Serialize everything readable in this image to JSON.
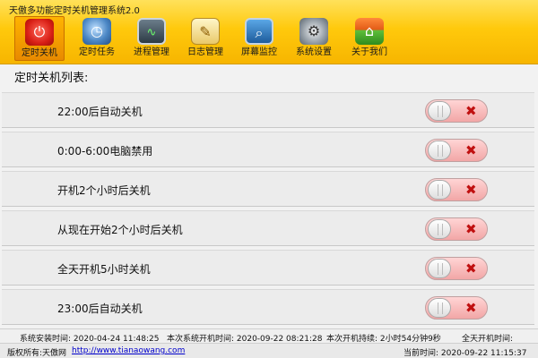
{
  "app": {
    "title": "天傲多功能定时关机管理系统2.0"
  },
  "toolbar": {
    "items": [
      {
        "label": "定时关机",
        "icon": "power-icon",
        "active": true
      },
      {
        "label": "定时任务",
        "icon": "clock-icon",
        "active": false
      },
      {
        "label": "进程管理",
        "icon": "process-monitor-icon",
        "active": false
      },
      {
        "label": "日志管理",
        "icon": "notepad-icon",
        "active": false
      },
      {
        "label": "屏幕监控",
        "icon": "screen-monitor-icon",
        "active": false
      },
      {
        "label": "系统设置",
        "icon": "gear-icon",
        "active": false
      },
      {
        "label": "关于我们",
        "icon": "house-icon",
        "active": false
      }
    ]
  },
  "list": {
    "title": "定时关机列表:",
    "rows": [
      {
        "label": "22:00后自动关机",
        "enabled": false
      },
      {
        "label": "0:00-6:00电脑禁用",
        "enabled": false
      },
      {
        "label": "开机2个小时后关机",
        "enabled": false
      },
      {
        "label": "从现在开始2个小时后关机",
        "enabled": false
      },
      {
        "label": "全天开机5小时关机",
        "enabled": false
      },
      {
        "label": "23:00后自动关机",
        "enabled": false
      }
    ]
  },
  "status": {
    "install_time": "系统安装时间: 2020-04-24 11:48:25",
    "boot_time": "本次系统开机时间: 2020-09-22 08:21:28",
    "uptime": "本次开机持续: 2小时54分钟9秒",
    "all_day_time": "全天开机时间:",
    "copyright": "版权所有:天傲网",
    "website": "http://www.tianaowang.com",
    "current_time": "当前时间: 2020-09-22 11:15:37"
  },
  "colors": {
    "toolbar": "#ffc90c",
    "toggle_off": "#f2a6a6",
    "close_x": "#c01010"
  }
}
